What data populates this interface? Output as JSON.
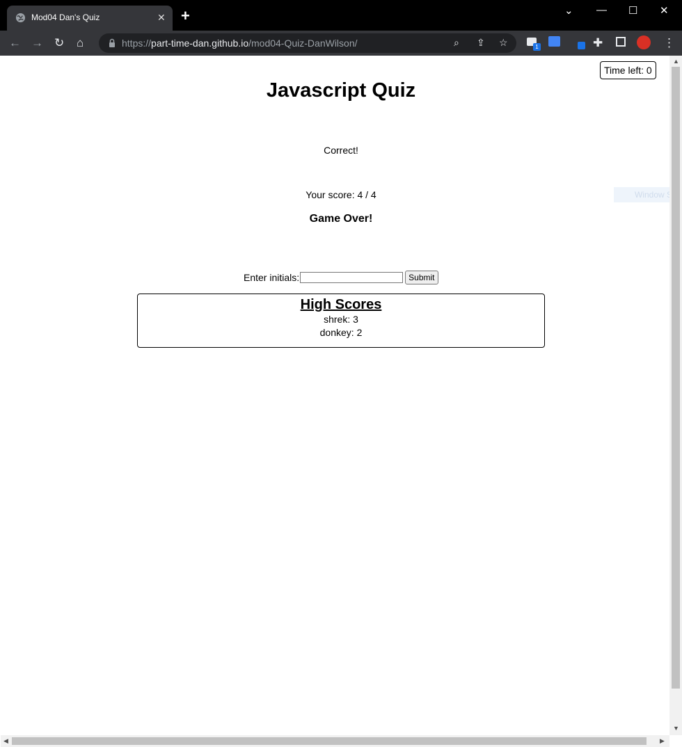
{
  "browser": {
    "tab_title": "Mod04 Dan's Quiz",
    "url_scheme": "https://",
    "url_host": "part-time-dan.github.io",
    "url_path": "/mod04-Quiz-DanWilson/",
    "extension_badge": "1"
  },
  "quiz": {
    "timer": "Time left: 0",
    "title": "Javascript Quiz",
    "feedback": "Correct!",
    "score": "Your score: 4 / 4",
    "game_over": "Game Over!",
    "initials_label": "Enter initials:",
    "initials_value": "",
    "submit_label": "Submit"
  },
  "high_scores": {
    "title": "High Scores",
    "entries": [
      "shrek: 3",
      "donkey: 2"
    ]
  },
  "overlay": {
    "text": "Window Sni"
  }
}
